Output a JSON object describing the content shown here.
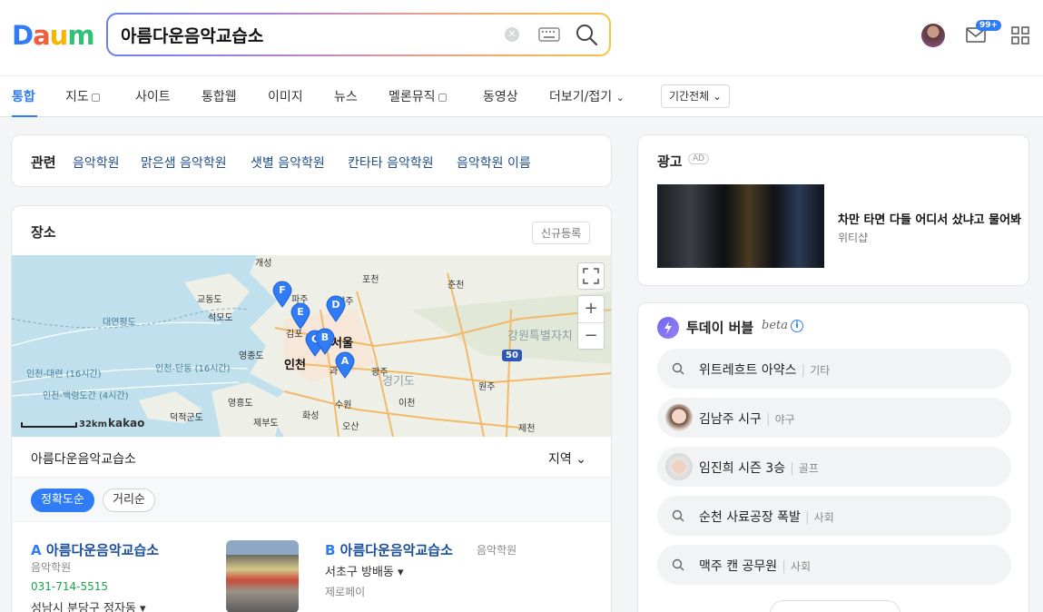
{
  "header": {
    "logo_letters": [
      "D",
      "a",
      "u",
      "m"
    ],
    "logo_colors": [
      "#2f7cf6",
      "#f25d3b",
      "#f7b500",
      "#2ec276"
    ],
    "search_value": "아름다운음악교습소",
    "notification_count": "99+"
  },
  "tabs": {
    "items": [
      "통합",
      "지도",
      "사이트",
      "통합웹",
      "이미지",
      "뉴스",
      "멜론뮤직",
      "동영상",
      "더보기/접기"
    ],
    "period": "기간전체 ⌄"
  },
  "related": {
    "title": "관련",
    "links": [
      "음악학원",
      "맑은샘 음악학원",
      "샛별 음악학원",
      "칸타타 음악학원",
      "음악학원 이름"
    ]
  },
  "place": {
    "title": "장소",
    "register_label": "신규등록",
    "map": {
      "labels": {
        "gaeseong": "개성",
        "pocheon": "포천",
        "chuncheon": "춘천",
        "gyodong": "교동도",
        "paju": "파주",
        "seongmo": "석모도",
        "yangju": "양주",
        "yeonpyeong": "대연평도",
        "gimpo": "김포",
        "seoul": "서울",
        "gangwon": "강원특별자치",
        "yeongjong": "영종도",
        "incheon": "인천",
        "gwacheon": "과",
        "gwangju": "광주",
        "gyeonggi": "경기도",
        "incheon_daeyeon": "인천-대련 (16시간)",
        "incheon_dandong": "인천-단동 (16시간)",
        "incheon_baekryeong": "인천-백령도간 (4시간)",
        "wonju": "원주",
        "yeongheung": "영흥도",
        "suwon": "수원",
        "icheon": "이천",
        "deokjeok": "덕적군도",
        "hwaseong": "화성",
        "jebu": "제부도",
        "osan": "오산",
        "jecheon": "제천",
        "highway": "50"
      },
      "scale_label": "32km",
      "brand": "kakao",
      "pins": [
        "A",
        "B",
        "C",
        "D",
        "E",
        "F"
      ],
      "zoom_in": "+",
      "zoom_out": "−"
    },
    "result_header": "아름다운음악교습소",
    "region_label": "지역 ⌄",
    "sort": {
      "accuracy": "정확도순",
      "distance": "거리순"
    },
    "results": [
      {
        "letter": "A",
        "name": "아름다운음악교습소",
        "category": "음악학원",
        "phone": "031-714-5515",
        "address": "성남시 분당구 정자동 ▾"
      },
      {
        "letter": "B",
        "name": "아름다운음악교습소",
        "category": "음악학원",
        "address": "서초구 방배동 ▾",
        "pay": "제로페이"
      }
    ]
  },
  "ad": {
    "title": "광고",
    "tag": "AD",
    "text": "차만 타면 다들 어디서 샀냐고 물어봐",
    "sponsor": "위티샵"
  },
  "bubble": {
    "title": "투데이 버블",
    "beta": "beta",
    "info": "i",
    "items": [
      {
        "query": "위트레흐트 아약스",
        "category": "기타"
      },
      {
        "query": "김남주 시구",
        "category": "야구"
      },
      {
        "query": "임진희 시즌 3승",
        "category": "골프"
      },
      {
        "query": "순천 사료공장 폭발",
        "category": "사회"
      },
      {
        "query": "맥주 캔 공무원",
        "category": "사회"
      }
    ]
  }
}
